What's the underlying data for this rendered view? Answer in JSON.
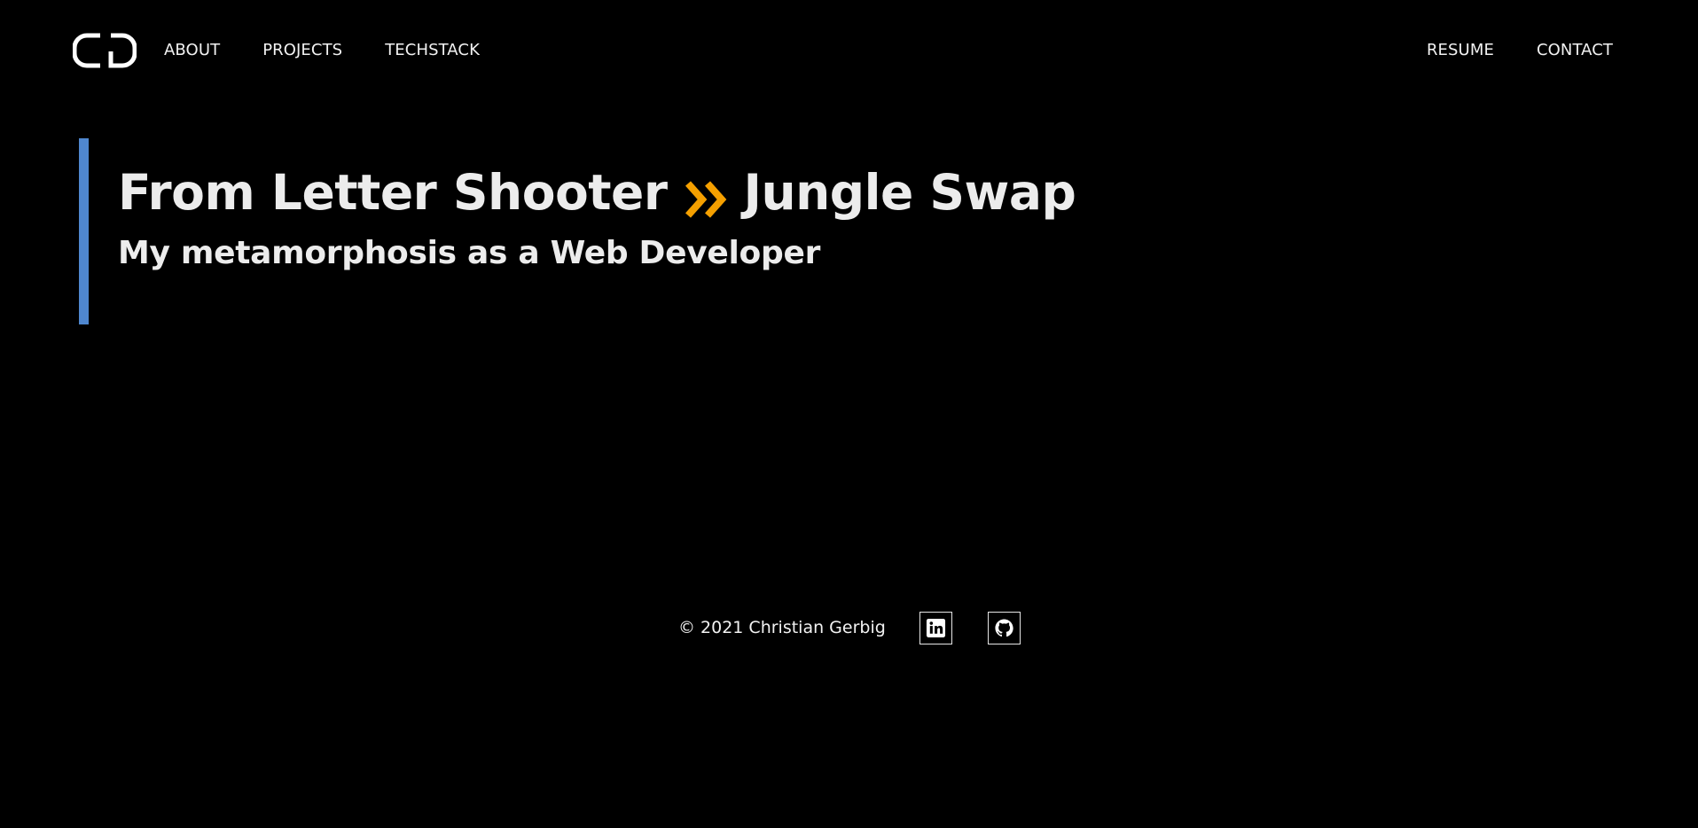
{
  "header": {
    "logo_icon": "cd-monogram-logo",
    "nav_left": [
      {
        "label": "ABOUT"
      },
      {
        "label": "PROJECTS"
      },
      {
        "label": "TECHSTACK"
      }
    ],
    "nav_right": [
      {
        "label": "RESUME"
      },
      {
        "label": "CONTACT"
      }
    ]
  },
  "hero": {
    "title_from": "From Letter Shooter",
    "title_arrow_icon": "double-chevron-right-icon",
    "title_to": "Jungle Swap",
    "subtitle": "My metamorphosis as a Web Developer"
  },
  "footer": {
    "copyright": "© 2021 Christian Gerbig",
    "social": [
      {
        "icon": "linkedin-icon"
      },
      {
        "icon": "github-icon"
      }
    ]
  },
  "colors": {
    "background": "#000000",
    "text": "#ececec",
    "accent_bar": "#4f87cf",
    "arrow": "#f5a000"
  }
}
